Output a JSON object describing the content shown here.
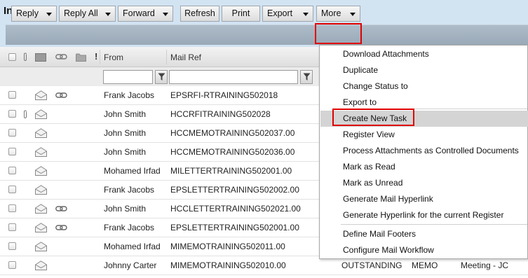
{
  "window": {
    "title": "Inbox"
  },
  "toolbar": {
    "reply": "Reply",
    "reply_all": "Reply All",
    "forward": "Forward",
    "refresh": "Refresh",
    "print": "Print",
    "export": "Export",
    "more": "More"
  },
  "columns": {
    "from": "From",
    "mail_ref": "Mail Ref"
  },
  "rows": [
    {
      "from": "Frank Jacobs",
      "mail_ref": "EPSRFI-RTRAINING502018",
      "attachment": false,
      "link": true
    },
    {
      "from": "John Smith",
      "mail_ref": "HCCRFITRAINING502028",
      "attachment": true,
      "link": false
    },
    {
      "from": "John Smith",
      "mail_ref": "HCCMEMOTRAINING502037.00",
      "attachment": false,
      "link": false
    },
    {
      "from": "John Smith",
      "mail_ref": "HCCMEMOTRAINING502036.00",
      "attachment": false,
      "link": false
    },
    {
      "from": "Mohamed Irfad",
      "mail_ref": "MILETTERTRAINING502001.00",
      "attachment": false,
      "link": false
    },
    {
      "from": "Frank Jacobs",
      "mail_ref": "EPSLETTERTRAINING502002.00",
      "attachment": false,
      "link": false
    },
    {
      "from": "John Smith",
      "mail_ref": "HCCLETTERTRAINING502021.00",
      "attachment": false,
      "link": true
    },
    {
      "from": "Frank Jacobs",
      "mail_ref": "EPSLETTERTRAINING502001.00",
      "attachment": false,
      "link": true
    },
    {
      "from": "Mohamed Irfad",
      "mail_ref": "MIMEMOTRAINING502011.00",
      "attachment": false,
      "link": false
    },
    {
      "from": "Johnny Carter",
      "mail_ref": "MIMEMOTRAINING502010.00",
      "attachment": false,
      "link": false,
      "status": "OUTSTANDING",
      "type": "MEMO",
      "subject": "Meeting - JC"
    }
  ],
  "more_menu": {
    "items": [
      "Download Attachments",
      "Duplicate",
      "Change Status to",
      "Export to",
      "Create New Task",
      "Register View",
      "Process Attachments as Controlled Documents",
      "Mark as Read",
      "Mark as Unread",
      "Generate Mail Hyperlink",
      "Generate Hyperlink for the current Register",
      "Define Mail Footers",
      "Configure Mail Workflow"
    ],
    "active_item": "Create New Task"
  },
  "colors": {
    "highlight": "#e00000",
    "header_bg": "#d2e3f2",
    "toolbar_strip": "#a5b3c0"
  }
}
